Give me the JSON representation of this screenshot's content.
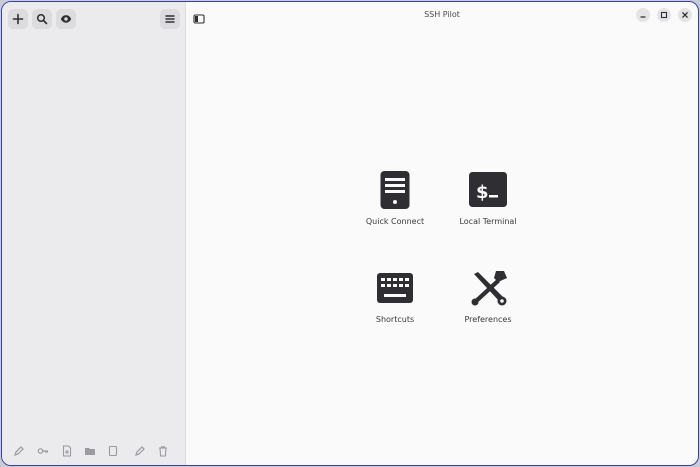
{
  "window": {
    "title": "SSH Pilot"
  },
  "sidebar": {
    "top_buttons": [
      {
        "name": "add-icon"
      },
      {
        "name": "search-icon"
      },
      {
        "name": "eye-icon"
      },
      {
        "name": "menu-icon"
      }
    ],
    "bottom_icons": [
      "pencil-icon",
      "key-icon",
      "file-add-icon",
      "folder-icon",
      "copy-icon",
      "edit-icon",
      "trash-icon"
    ]
  },
  "main": {
    "tiles": [
      {
        "label": "Quick Connect",
        "icon": "server-icon"
      },
      {
        "label": "Local Terminal",
        "icon": "terminal-icon"
      },
      {
        "label": "Shortcuts",
        "icon": "keyboard-icon"
      },
      {
        "label": "Preferences",
        "icon": "tools-icon"
      }
    ]
  },
  "colors": {
    "accent": "#3a3fa6",
    "icon": "#2e2e33",
    "sidebar": "#ebebed"
  }
}
